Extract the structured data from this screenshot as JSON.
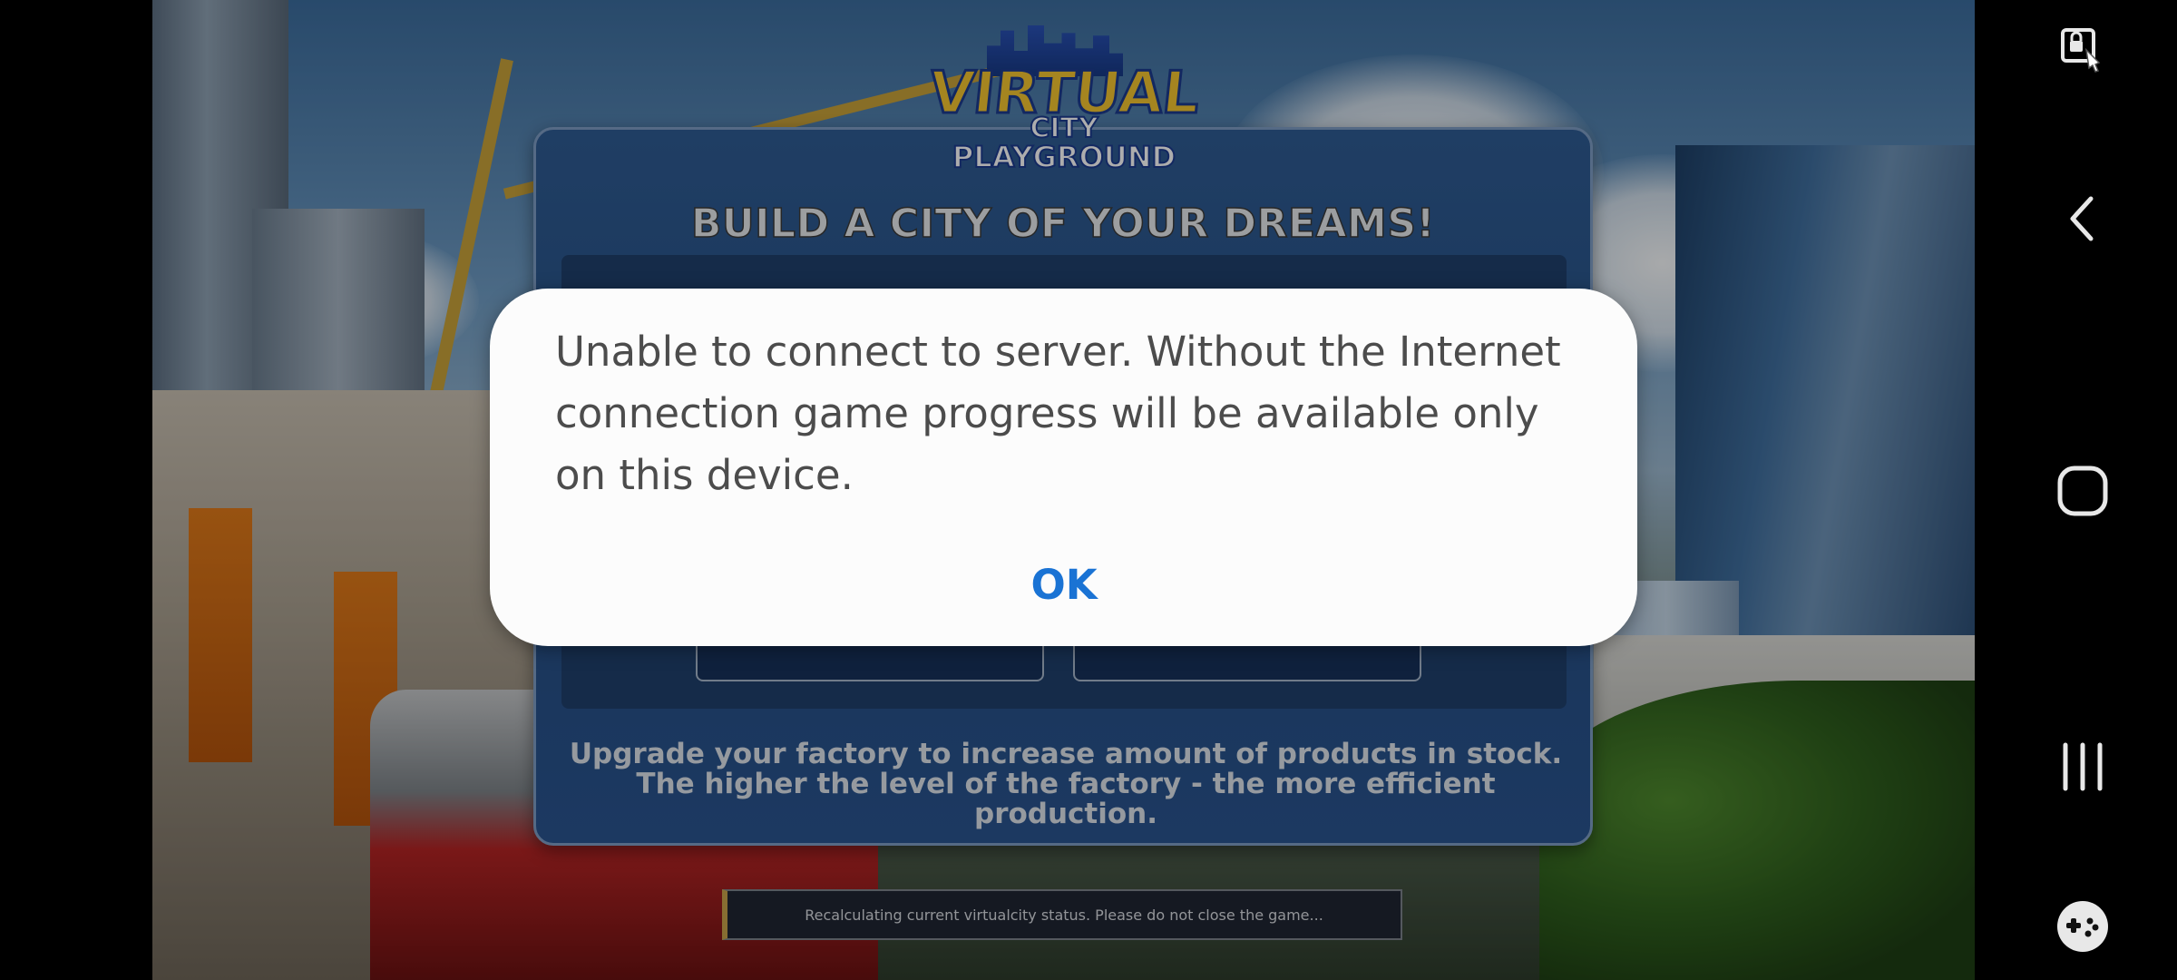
{
  "game": {
    "panel_title": "BUILD A CITY OF YOUR DREAMS!",
    "panel_description": "Upgrade your factory to increase amount of products in stock. The higher the level of the factory - the more efficient production.",
    "status_text": "Recalculating current virtualcity status. Please do not close the game...",
    "logo": {
      "line1": "VIRTUAL",
      "line2": "CITY",
      "line3": "PLAYGROUND"
    }
  },
  "dialog": {
    "message": "Unable to connect to server. Without the Internet connection game progress will be available only on this device.",
    "ok_label": "OK"
  },
  "navbar": {
    "icons": [
      "screen-lock-icon",
      "back-icon",
      "home-icon",
      "recents-icon",
      "game-tools-icon"
    ]
  },
  "colors": {
    "dialog_button": "#1a73d4",
    "panel_bg": "#2f5c94",
    "dialog_bg": "#fcfcfc"
  }
}
